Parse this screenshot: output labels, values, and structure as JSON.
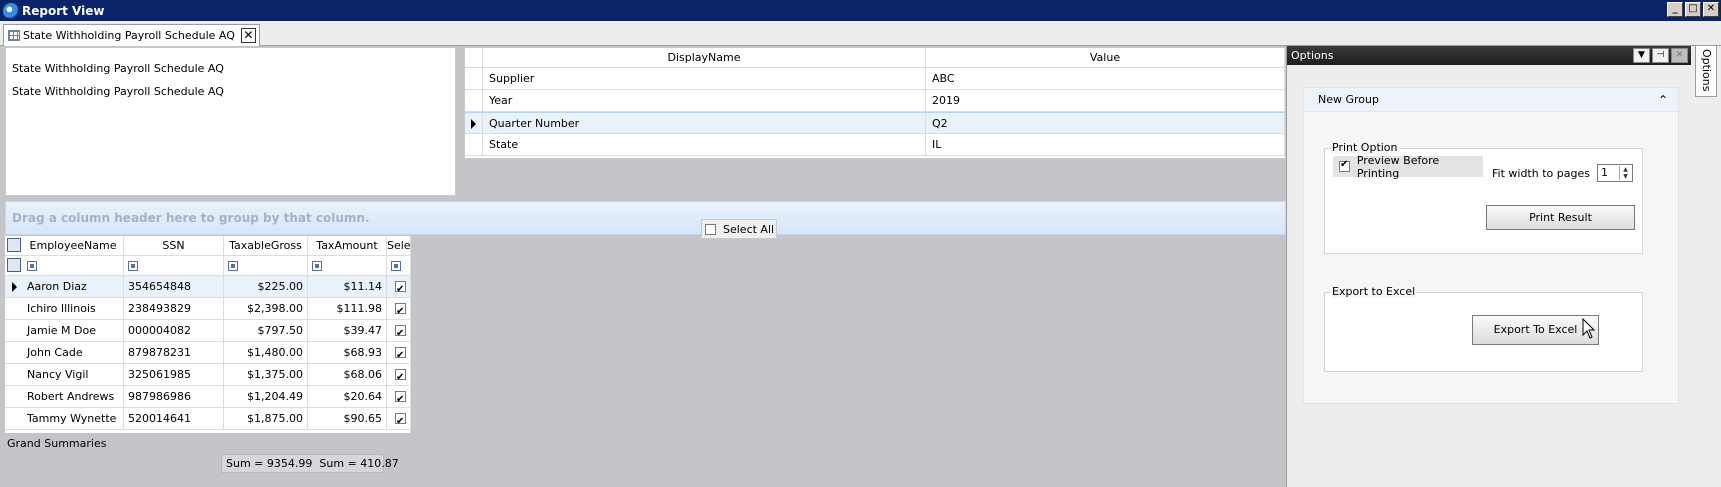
{
  "window": {
    "title": "Report View",
    "buttons": [
      "_",
      "□",
      "✕"
    ]
  },
  "doc_tab": {
    "label": "State Withholding Payroll Schedule AQ"
  },
  "report_list": {
    "items": [
      "State Withholding Payroll Schedule AQ",
      "State Withholding Payroll Schedule AQ"
    ]
  },
  "param_grid": {
    "headers": {
      "name": "DisplayName",
      "value": "Value"
    },
    "rows": [
      {
        "name": "Supplier",
        "value": "ABC"
      },
      {
        "name": "Year",
        "value": "2019"
      },
      {
        "name": "Quarter Number",
        "value": "Q2"
      },
      {
        "name": "State",
        "value": "IL"
      }
    ]
  },
  "group_bar": {
    "hint": "Drag a column header here to group by that column."
  },
  "select_all": {
    "label": "Select All"
  },
  "data_grid": {
    "headers": {
      "name": "EmployeeName",
      "ssn": "SSN",
      "gross": "TaxableGross",
      "tax": "TaxAmount",
      "select": "Sele"
    },
    "rows": [
      {
        "name": "Aaron Diaz",
        "ssn": "354654848",
        "gross": "$225.00",
        "tax": "$11.14"
      },
      {
        "name": "Ichiro Illinois",
        "ssn": "238493829",
        "gross": "$2,398.00",
        "tax": "$111.98"
      },
      {
        "name": "Jamie M Doe",
        "ssn": "000004082",
        "gross": "$797.50",
        "tax": "$39.47"
      },
      {
        "name": "John Cade",
        "ssn": "879878231",
        "gross": "$1,480.00",
        "tax": "$68.93"
      },
      {
        "name": "Nancy Vigil",
        "ssn": "325061985",
        "gross": "$1,375.00",
        "tax": "$68.06"
      },
      {
        "name": "Robert Andrews",
        "ssn": "987986986",
        "gross": "$1,204.49",
        "tax": "$20.64"
      },
      {
        "name": "Tammy Wynette",
        "ssn": "520014641",
        "gross": "$1,875.00",
        "tax": "$90.65"
      }
    ]
  },
  "summaries": {
    "label": "Grand Summaries",
    "gross_sum": "Sum = 9354.99",
    "tax_sum": "Sum = 410.87"
  },
  "options": {
    "title": "Options",
    "group_title": "New Group",
    "print_option": {
      "legend": "Print Option",
      "preview_label": "Preview Before Printing",
      "fit_label": "Fit width to pages",
      "fit_value": "1",
      "print_button": "Print Result"
    },
    "export": {
      "legend": "Export to Excel",
      "button": "Export To Excel"
    },
    "side_tab": "Options"
  },
  "colors": {
    "titlebar": "#0a246a",
    "canvas": "#c5c4c8",
    "highlight_row": "#e9f2fb",
    "options_header": "#1e1e1e"
  }
}
